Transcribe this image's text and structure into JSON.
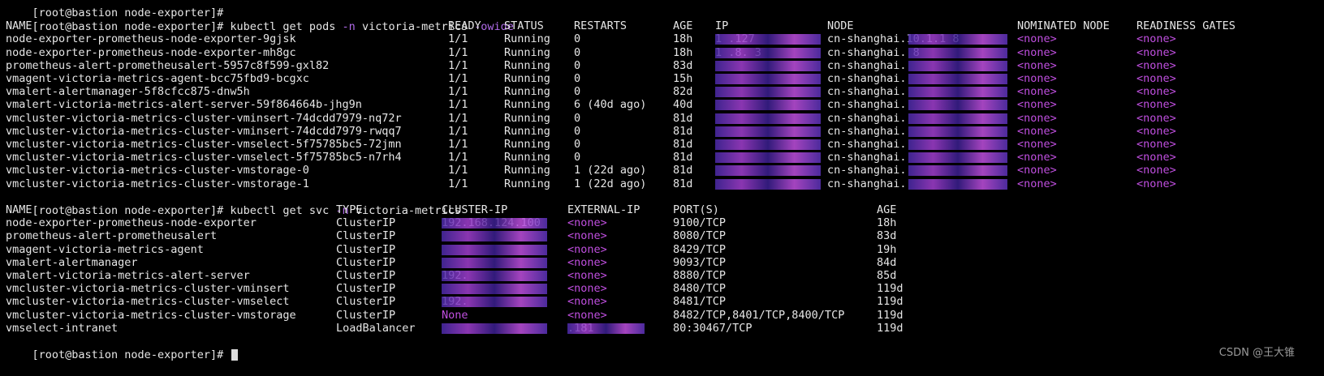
{
  "prompt1": {
    "prompt": "[root@bastion node-exporter]#",
    "cmd": "kubectl get pods",
    "flag_n": "-n",
    "ns": "victoria-metrics",
    "flag_o": "-owide"
  },
  "pods_header": [
    "NAME",
    "READY",
    "STATUS",
    "RESTARTS",
    "AGE",
    "IP",
    "NODE",
    "NOMINATED NODE",
    "READINESS GATES"
  ],
  "pods": [
    {
      "name": "node-exporter-prometheus-node-exporter-9gjsk",
      "ready": "1/1",
      "status": "Running",
      "restarts": "0",
      "age": "18h",
      "ip": "1 .127",
      "node": "cn-shanghai.10.1.1 8",
      "nominated": "<none>",
      "gates": "<none>"
    },
    {
      "name": "node-exporter-prometheus-node-exporter-mh8gc",
      "ready": "1/1",
      "status": "Running",
      "restarts": "0",
      "age": "18h",
      "ip": "1 .8. 3",
      "node": "cn-shanghai. 8",
      "nominated": "<none>",
      "gates": "<none>"
    },
    {
      "name": "prometheus-alert-prometheusalert-5957c8f599-gxl82",
      "ready": "1/1",
      "status": "Running",
      "restarts": "0",
      "age": "83d",
      "ip": "",
      "node": "cn-shanghai.",
      "nominated": "<none>",
      "gates": "<none>"
    },
    {
      "name": "vmagent-victoria-metrics-agent-bcc75fbd9-bcgxc",
      "ready": "1/1",
      "status": "Running",
      "restarts": "0",
      "age": "15h",
      "ip": "",
      "node": "cn-shanghai.",
      "nominated": "<none>",
      "gates": "<none>"
    },
    {
      "name": "vmalert-alertmanager-5f8cfcc875-dnw5h",
      "ready": "1/1",
      "status": "Running",
      "restarts": "0",
      "age": "82d",
      "ip": "",
      "node": "cn-shanghai.",
      "nominated": "<none>",
      "gates": "<none>"
    },
    {
      "name": "vmalert-victoria-metrics-alert-server-59f864664b-jhg9n",
      "ready": "1/1",
      "status": "Running",
      "restarts": "6 (40d ago)",
      "age": "40d",
      "ip": "",
      "node": "cn-shanghai.",
      "nominated": "<none>",
      "gates": "<none>"
    },
    {
      "name": "vmcluster-victoria-metrics-cluster-vminsert-74dcdd7979-nq72r",
      "ready": "1/1",
      "status": "Running",
      "restarts": "0",
      "age": "81d",
      "ip": "",
      "node": "cn-shanghai.",
      "nominated": "<none>",
      "gates": "<none>"
    },
    {
      "name": "vmcluster-victoria-metrics-cluster-vminsert-74dcdd7979-rwqq7",
      "ready": "1/1",
      "status": "Running",
      "restarts": "0",
      "age": "81d",
      "ip": "",
      "node": "cn-shanghai.",
      "nominated": "<none>",
      "gates": "<none>"
    },
    {
      "name": "vmcluster-victoria-metrics-cluster-vmselect-5f75785bc5-72jmn",
      "ready": "1/1",
      "status": "Running",
      "restarts": "0",
      "age": "81d",
      "ip": "",
      "node": "cn-shanghai.",
      "nominated": "<none>",
      "gates": "<none>"
    },
    {
      "name": "vmcluster-victoria-metrics-cluster-vmselect-5f75785bc5-n7rh4",
      "ready": "1/1",
      "status": "Running",
      "restarts": "0",
      "age": "81d",
      "ip": "",
      "node": "cn-shanghai.",
      "nominated": "<none>",
      "gates": "<none>"
    },
    {
      "name": "vmcluster-victoria-metrics-cluster-vmstorage-0",
      "ready": "1/1",
      "status": "Running",
      "restarts": "1 (22d ago)",
      "age": "81d",
      "ip": "",
      "node": "cn-shanghai.",
      "nominated": "<none>",
      "gates": "<none>"
    },
    {
      "name": "vmcluster-victoria-metrics-cluster-vmstorage-1",
      "ready": "1/1",
      "status": "Running",
      "restarts": "1 (22d ago)",
      "age": "81d",
      "ip": "",
      "node": "cn-shanghai.",
      "nominated": "<none>",
      "gates": "<none>"
    }
  ],
  "prompt2": {
    "prompt": "[root@bastion node-exporter]#",
    "cmd": "kubectl get svc",
    "flag_n": "-n",
    "ns": "victoria-metrics"
  },
  "svc_header": [
    "NAME",
    "TYPE",
    "CLUSTER-IP",
    "EXTERNAL-IP",
    "PORT(S)",
    "AGE"
  ],
  "svcs": [
    {
      "name": "node-exporter-prometheus-node-exporter",
      "type": "ClusterIP",
      "cip": "192.168.124.100",
      "eip": "<none>",
      "ports": "9100/TCP",
      "age": "18h"
    },
    {
      "name": "prometheus-alert-prometheusalert",
      "type": "ClusterIP",
      "cip": "",
      "eip": "<none>",
      "ports": "8080/TCP",
      "age": "83d"
    },
    {
      "name": "vmagent-victoria-metrics-agent",
      "type": "ClusterIP",
      "cip": "",
      "eip": "<none>",
      "ports": "8429/TCP",
      "age": "19h"
    },
    {
      "name": "vmalert-alertmanager",
      "type": "ClusterIP",
      "cip": "",
      "eip": "<none>",
      "ports": "9093/TCP",
      "age": "84d"
    },
    {
      "name": "vmalert-victoria-metrics-alert-server",
      "type": "ClusterIP",
      "cip": "192.",
      "eip": "<none>",
      "ports": "8880/TCP",
      "age": "85d"
    },
    {
      "name": "vmcluster-victoria-metrics-cluster-vminsert",
      "type": "ClusterIP",
      "cip": "",
      "eip": "<none>",
      "ports": "8480/TCP",
      "age": "119d"
    },
    {
      "name": "vmcluster-victoria-metrics-cluster-vmselect",
      "type": "ClusterIP",
      "cip": "192.",
      "eip": "<none>",
      "ports": "8481/TCP",
      "age": "119d"
    },
    {
      "name": "vmcluster-victoria-metrics-cluster-vmstorage",
      "type": "ClusterIP",
      "cip": "None",
      "eip": "<none>",
      "ports": "8482/TCP,8401/TCP,8400/TCP",
      "age": "119d"
    },
    {
      "name": "vmselect-intranet",
      "type": "LoadBalancer",
      "cip": "",
      "eip": ".181",
      "ports": "80:30467/TCP",
      "age": "119d"
    }
  ],
  "prompt3": {
    "prompt": "[root@bastion node-exporter]#"
  },
  "watermark": "CSDN @王大锥",
  "colors": {
    "flag": "#b06be8",
    "none": "#c04fe0",
    "background": "#000000",
    "text": "#e6e6e6"
  }
}
